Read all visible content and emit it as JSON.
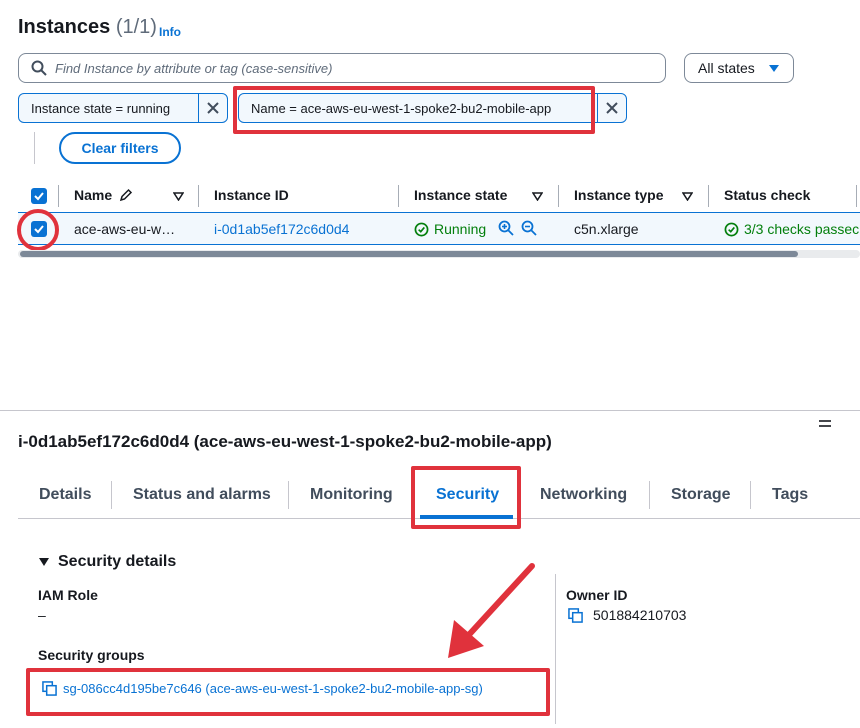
{
  "header": {
    "title": "Instances",
    "count": "(1/1)",
    "info_link": "Info"
  },
  "search": {
    "placeholder": "Find Instance by attribute or tag (case-sensitive)"
  },
  "states_select": {
    "selected": "All states"
  },
  "filters": [
    {
      "label": "Instance state = running"
    },
    {
      "label": "Name = ace-aws-eu-west-1-spoke2-bu2-mobile-app"
    }
  ],
  "clear_filters": "Clear filters",
  "table": {
    "columns": [
      "Name",
      "Instance ID",
      "Instance state",
      "Instance type",
      "Status check"
    ],
    "rows": [
      {
        "name": "ace-aws-eu-w…",
        "instance_id": "i-0d1ab5ef172c6d0d4",
        "state": "Running",
        "type": "c5n.xlarge",
        "status_check": "3/3 checks passec"
      }
    ]
  },
  "detail": {
    "title": "i-0d1ab5ef172c6d0d4 (ace-aws-eu-west-1-spoke2-bu2-mobile-app)",
    "tabs": [
      "Details",
      "Status and alarms",
      "Monitoring",
      "Security",
      "Networking",
      "Storage",
      "Tags"
    ],
    "active_tab": "Security",
    "section_title": "Security details",
    "iam_role_label": "IAM Role",
    "iam_role_value": "–",
    "owner_id_label": "Owner ID",
    "owner_id_value": "501884210703",
    "security_groups_label": "Security groups",
    "security_group_link": "sg-086cc4d195be7c646 (ace-aws-eu-west-1-spoke2-bu2-mobile-app-sg)"
  },
  "colors": {
    "accent": "#0972d3",
    "highlight": "#e0323c",
    "success": "#037f0c"
  }
}
